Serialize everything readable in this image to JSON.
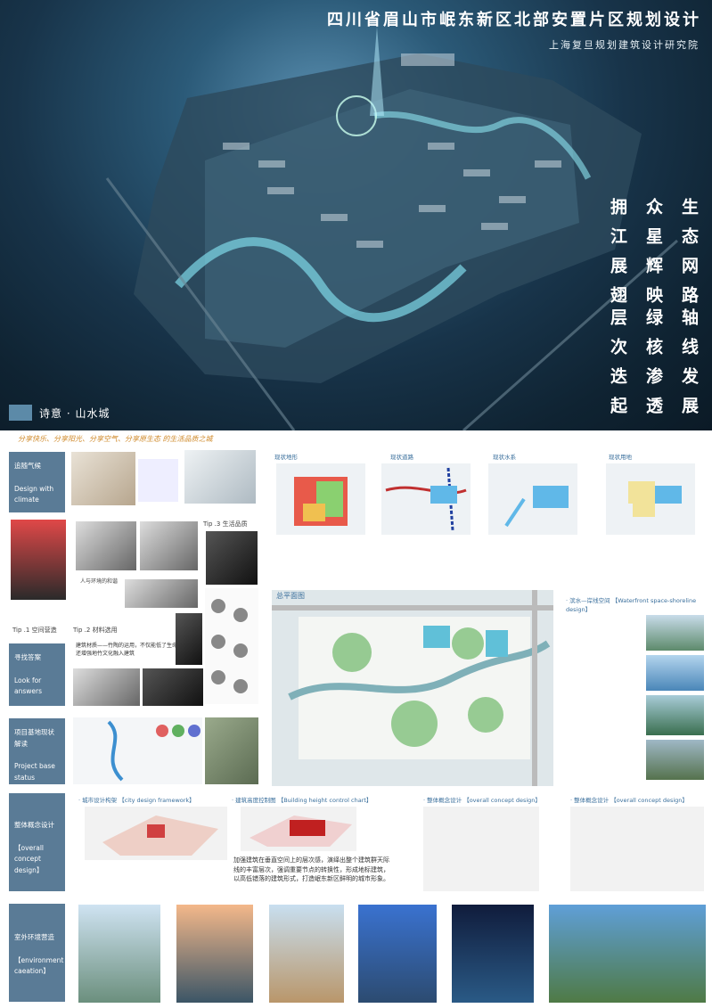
{
  "header": {
    "title": "四川省眉山市岷东新区北部安置片区规划设计",
    "institute": "上海复旦规划建筑设计研究院"
  },
  "poem": {
    "col1": "拥江展翅",
    "col2": "众星辉映",
    "col3": "生态网路",
    "col4": "层次迭起",
    "col5": "绿核渗透",
    "col6": "轴线发展"
  },
  "concept_title": "诗意 · 山水城",
  "slogan": "分享快乐、分享阳光、分享空气、分享原生态 的生活品质之城",
  "sidebar": {
    "s1": "追随气候\n\nDesign with climate",
    "s2": "寻找答案\n\nLook for answers",
    "s3": "项目基地现状解读\n\nProject base status interpretation",
    "s4": "整体概念设计\n\n【overall concept design】",
    "s5": "室外环境营造\n\n【environment caeation】"
  },
  "tips": {
    "tip1": "Tip .1  空间营造",
    "tip2": "Tip .2  材料选用",
    "tip3": "Tip .3  生活品质",
    "nature": "人与环境的和谐"
  },
  "panels": {
    "p1": "现状地形",
    "p2": "现状道路",
    "p3": "现状水系",
    "p4": "现状用地"
  },
  "plan_title": "总平面图",
  "waterfront": "· 滨水—岸线空间 【Waterfront space-shoreline design】",
  "framework": "· 城市设计构架 【city design framework】",
  "height": "· 建筑高度控制图 【Building height control chart】",
  "overall1": "· 整体概念设计 【overall concept design】",
  "overall2": "· 整体概念设计 【overall concept design】",
  "height_text": "加强建筑在垂直空间上的层次感，演绎出整个建筑群天际线的丰富层次，强调重要节点的转换性，形成地标建筑，以高低错落的建筑形式，打造岷东新区鲜明的城市形象。",
  "material_text": "建筑材质——竹陶的运用，不仅能低了生命单位区，还增强地竹文化融入建筑",
  "colors": {
    "accent": "#5a7b96",
    "title": "#ffffff"
  }
}
